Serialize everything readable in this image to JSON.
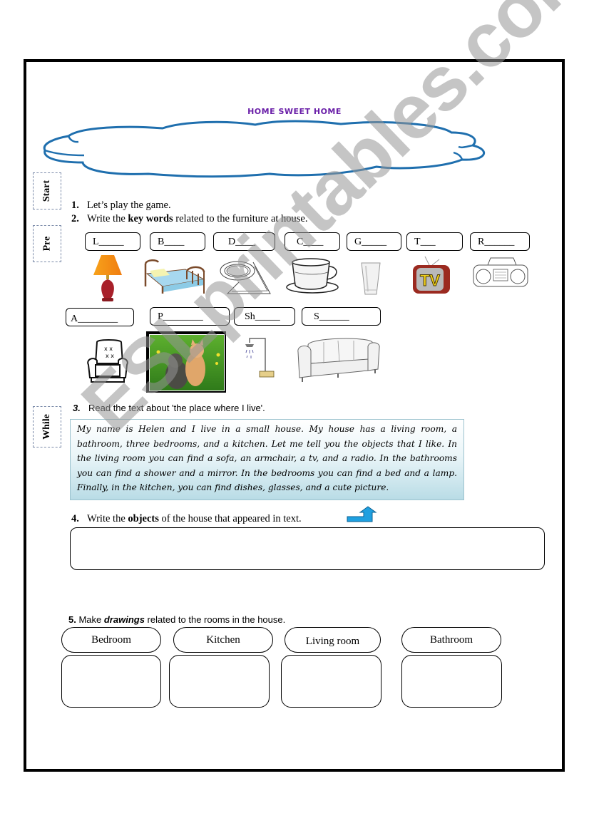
{
  "title": "HOME SWEET HOME",
  "stages": {
    "start": "Start",
    "pre": "Pre",
    "while": "While"
  },
  "tasks": {
    "t1": {
      "num": "1.",
      "text": "Let’s play the game."
    },
    "t2": {
      "num": "2.",
      "pre": "Write the ",
      "bold": "key words",
      "post": " related to the furniture at house."
    },
    "t3": {
      "num": "3.",
      "text": "Read the text about 'the place where I live'."
    },
    "t4": {
      "num": "4.",
      "pre": "Write the ",
      "bold": "objects",
      "post": " of the house that appeared in text."
    },
    "t5": {
      "num": "5.",
      "pre": " Make ",
      "bold": "drawings",
      "post": " related to the rooms in the house."
    }
  },
  "keywords_row1": [
    {
      "letter": "L",
      "blank": "_____",
      "image": "lamp-icon"
    },
    {
      "letter": "B",
      "blank": "____",
      "image": "bed-icon"
    },
    {
      "letter": "D",
      "blank": "____",
      "image": "dishes-icon"
    },
    {
      "letter": "C",
      "blank": "____",
      "image": "cup-icon"
    },
    {
      "letter": "G",
      "blank": "_____",
      "image": "glass-icon"
    },
    {
      "letter": "T",
      "blank": "___",
      "image": "tv-icon"
    },
    {
      "letter": "R",
      "blank": "______",
      "image": "radio-icon"
    }
  ],
  "keywords_row2": [
    {
      "letter": "A",
      "blank": "________",
      "image": "armchair-icon"
    },
    {
      "letter": "P",
      "blank": "________",
      "image": "picture-icon"
    },
    {
      "letter": "Sh",
      "blank": "_____",
      "image": "shower-icon"
    },
    {
      "letter": "S",
      "blank": "______",
      "image": "sofa-icon"
    }
  ],
  "tv_label": "TV",
  "reading_text": "My name is Helen and I live in a small house. My house has a living room, a bathroom, three bedrooms, and a kitchen. Let me tell you the objects that I like. In the living room you can find a sofa, an armchair, a tv, and a radio. In the bathrooms you can find a shower and a mirror. In the bedrooms you can find a bed and a lamp. Finally, in the kitchen, you can find dishes, glasses, and a cute picture.",
  "rooms": [
    "Bedroom",
    "Kitchen",
    "Living room",
    "Bathroom"
  ],
  "watermark": "ESLprintables.com",
  "colors": {
    "title": "#6a1fa8",
    "cloud": "#1f6fae",
    "arrow": "#1fa0e0",
    "border": "#000000"
  }
}
